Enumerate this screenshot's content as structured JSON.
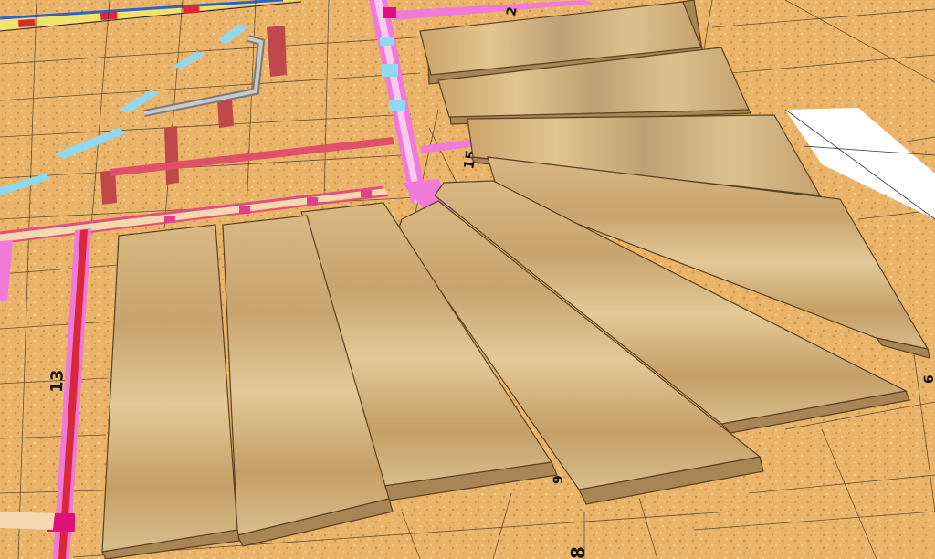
{
  "scene": {
    "description_colors": {
      "floor": "#e9b46a",
      "floor_speckle": "#d9963f",
      "grid_line": "#3a2a18",
      "wall_pink": "#e0507a",
      "wall_magenta": "#f07ad8",
      "wall_red": "#d8283a",
      "cyan_patch": "#8fd8f0",
      "tread_light": "#e2c48e",
      "tread_mid": "#c9a46c",
      "tread_dark": "#a88555",
      "tread_edge": "#8b6a3e",
      "white_shape": "#ffffff"
    },
    "labels": {
      "stair_13": "13",
      "stair_15": "15",
      "stair_8": "8",
      "stair_9": "9",
      "stair_2": "2",
      "stair_6": "6"
    }
  }
}
